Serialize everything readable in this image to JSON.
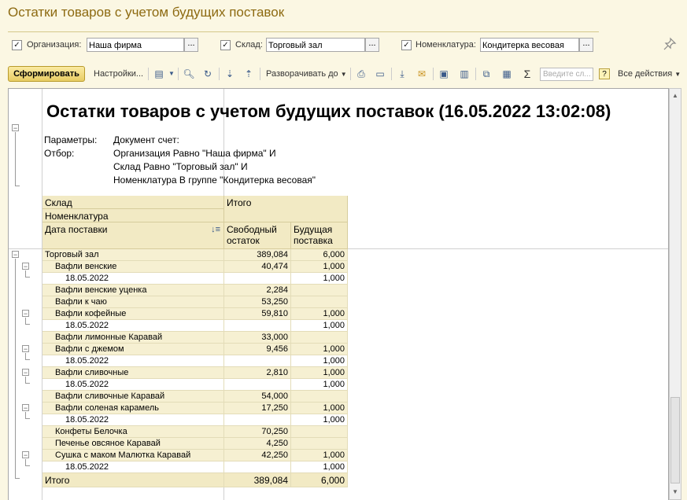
{
  "window": {
    "title": "Остатки товаров с учетом будущих поставок"
  },
  "filters": {
    "organization": {
      "label": "Организация:",
      "value": "Наша фирма",
      "checked": true
    },
    "warehouse": {
      "label": "Склад:",
      "value": "Торговый зал",
      "checked": true
    },
    "nomenclature": {
      "label": "Номенклатура:",
      "value": "Кондитерка весовая",
      "checked": true
    },
    "select_button": "..."
  },
  "toolbar": {
    "generate": "Сформировать",
    "settings": "Настройки...",
    "expand_to": "Разворачивать до",
    "search_placeholder": "Введите сл...",
    "help": "?",
    "all_actions": "Все действия"
  },
  "report": {
    "title": "Остатки товаров с учетом будущих поставок (16.05.2022 13:02:08)",
    "params_label": "Параметры:",
    "params_value": "Документ счет:",
    "filter_label": "Отбор:",
    "filter_lines": [
      "Организация Равно \"Наша фирма\" И",
      "Склад Равно \"Торговый зал\" И",
      "Номенклатура В группе \"Кондитерка весовая\""
    ],
    "headers": {
      "warehouse": "Склад",
      "nomenclature": "Номенклатура",
      "delivery_date": "Дата поставки",
      "total": "Итого",
      "free_stock_1": "Свободный",
      "free_stock_2": "остаток",
      "future_supply_1": "Будущая",
      "future_supply_2": "поставка"
    },
    "rows": [
      {
        "name": "Торговый зал",
        "free": "389,084",
        "future": "6,000",
        "level": 0
      },
      {
        "name": "Вафли венские",
        "free": "40,474",
        "future": "1,000",
        "level": 1
      },
      {
        "name": "18.05.2022",
        "free": "",
        "future": "1,000",
        "level": 2
      },
      {
        "name": "Вафли венские уценка",
        "free": "2,284",
        "future": "",
        "level": 1
      },
      {
        "name": "Вафли к чаю",
        "free": "53,250",
        "future": "",
        "level": 1
      },
      {
        "name": "Вафли кофейные",
        "free": "59,810",
        "future": "1,000",
        "level": 1
      },
      {
        "name": "18.05.2022",
        "free": "",
        "future": "1,000",
        "level": 2
      },
      {
        "name": "Вафли лимонные Каравай",
        "free": "33,000",
        "future": "",
        "level": 1
      },
      {
        "name": "Вафли с джемом",
        "free": "9,456",
        "future": "1,000",
        "level": 1
      },
      {
        "name": "18.05.2022",
        "free": "",
        "future": "1,000",
        "level": 2
      },
      {
        "name": "Вафли сливочные",
        "free": "2,810",
        "future": "1,000",
        "level": 1
      },
      {
        "name": "18.05.2022",
        "free": "",
        "future": "1,000",
        "level": 2
      },
      {
        "name": "Вафли сливочные Каравай",
        "free": "54,000",
        "future": "",
        "level": 1
      },
      {
        "name": "Вафли соленая карамель",
        "free": "17,250",
        "future": "1,000",
        "level": 1
      },
      {
        "name": "18.05.2022",
        "free": "",
        "future": "1,000",
        "level": 2
      },
      {
        "name": "Конфеты Белочка",
        "free": "70,250",
        "future": "",
        "level": 1
      },
      {
        "name": "Печенье овсяное Каравай",
        "free": "4,250",
        "future": "",
        "level": 1
      },
      {
        "name": "Сушка с маком Малютка Каравай",
        "free": "42,250",
        "future": "1,000",
        "level": 1
      },
      {
        "name": "18.05.2022",
        "free": "",
        "future": "1,000",
        "level": 2
      }
    ],
    "total": {
      "name": "Итого",
      "free": "389,084",
      "future": "6,000"
    }
  }
}
